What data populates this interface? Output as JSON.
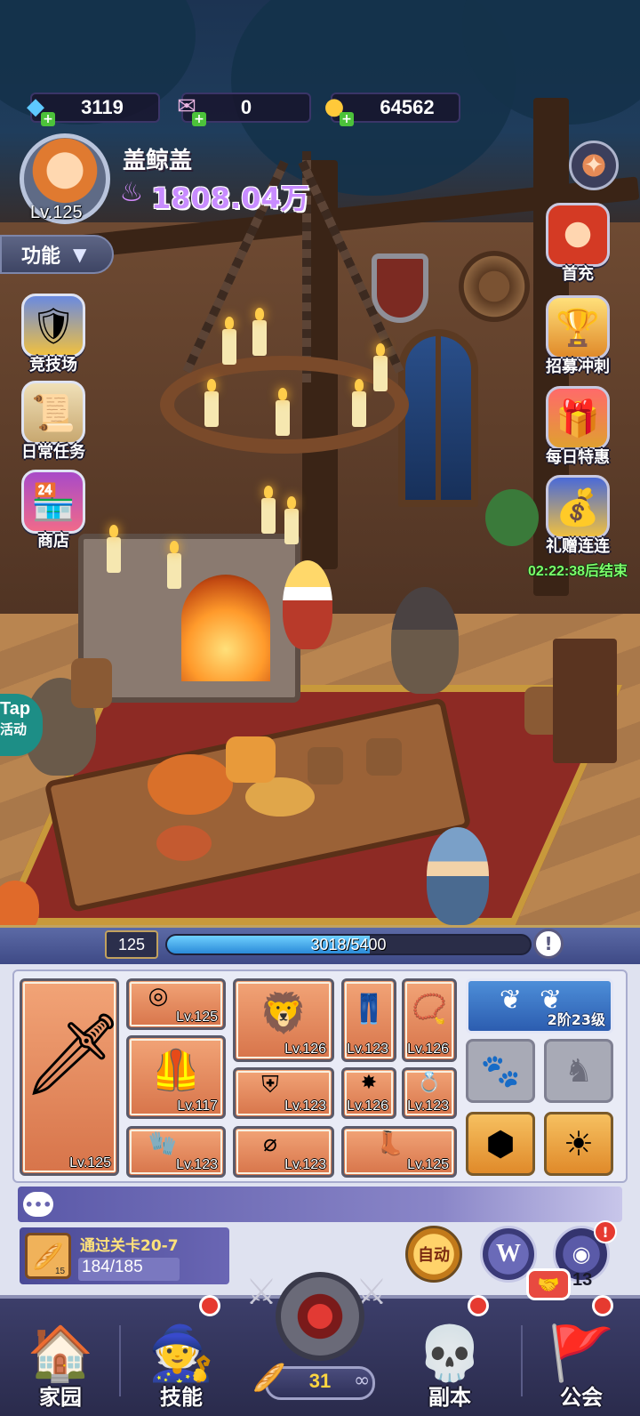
{
  "resources": {
    "diamonds": "3119",
    "tickets": "0",
    "gold": "64562"
  },
  "player": {
    "name": "盖鲸盖",
    "level": "Lv.125",
    "power": "1808.04万"
  },
  "menu": {
    "function_label": "功能"
  },
  "left_sidebar": [
    {
      "label": "竞技场",
      "icon": "arena-shield-icon"
    },
    {
      "label": "日常任务",
      "icon": "scroll-icon"
    },
    {
      "label": "商店",
      "icon": "shop-stall-icon"
    }
  ],
  "right_sidebar": [
    {
      "label": "首充",
      "icon": "red-hair-hero-icon"
    },
    {
      "label": "招募冲刺",
      "icon": "trophy-icon"
    },
    {
      "label": "每日特惠",
      "icon": "gift-box-icon"
    },
    {
      "label": "礼赠连连",
      "icon": "gift-bag-icon"
    }
  ],
  "promo_timer": "02:22:38后结束",
  "tap_event": {
    "line1": "Tap",
    "line2": "活动"
  },
  "exp": {
    "level": "125",
    "text": "3018/5400",
    "fraction": 0.559
  },
  "equipment": [
    {
      "slot": "weapon",
      "level": "Lv.125",
      "icon": "serrated-sword-icon"
    },
    {
      "slot": "helmet-ring",
      "level": "Lv.125",
      "icon": "ring-icon"
    },
    {
      "slot": "armor",
      "level": "Lv.117",
      "icon": "chest-armor-icon"
    },
    {
      "slot": "gloves",
      "level": "Lv.123",
      "icon": "gauntlet-icon"
    },
    {
      "slot": "lion-helm",
      "level": "Lv.126",
      "icon": "lion-helm-icon"
    },
    {
      "slot": "shoulder",
      "level": "Lv.123",
      "icon": "shoulder-pad-icon"
    },
    {
      "slot": "belt",
      "level": "Lv.123",
      "icon": "belt-icon"
    },
    {
      "slot": "pants",
      "level": "Lv.123",
      "icon": "pants-icon"
    },
    {
      "slot": "necklace",
      "level": "Lv.126",
      "icon": "necklace-icon"
    },
    {
      "slot": "amulet",
      "level": "Lv.126",
      "icon": "amulet-icon"
    },
    {
      "slot": "ring2",
      "level": "Lv.123",
      "icon": "red-ring-icon"
    },
    {
      "slot": "boots",
      "level": "Lv.125",
      "icon": "boots-icon"
    }
  ],
  "wings": {
    "label": "2阶23级",
    "icon": "wings-icon"
  },
  "locked_slots": [
    "paw-lock-icon",
    "horse-lock-icon"
  ],
  "gem_slots": [
    "hex-gem-icon",
    "sun-gem-icon"
  ],
  "quest": {
    "title": "通过关卡20-7",
    "progress": "184/185",
    "icon_badge": "15"
  },
  "actions": {
    "auto": "自动",
    "w": "W",
    "idle_count": "13"
  },
  "nav": [
    {
      "label": "家园",
      "icon": "home-icon"
    },
    {
      "label": "技能",
      "icon": "hooded-mage-icon"
    },
    {
      "label": "副本",
      "icon": "viking-skull-icon"
    },
    {
      "label": "公会",
      "icon": "guild-banner-icon"
    }
  ],
  "stage": {
    "number": "31"
  },
  "colors": {
    "accent_purple": "#c88cff",
    "timer_green": "#7cff6a",
    "equip_orange": "#e08a55",
    "badge_red": "#e63a30"
  }
}
